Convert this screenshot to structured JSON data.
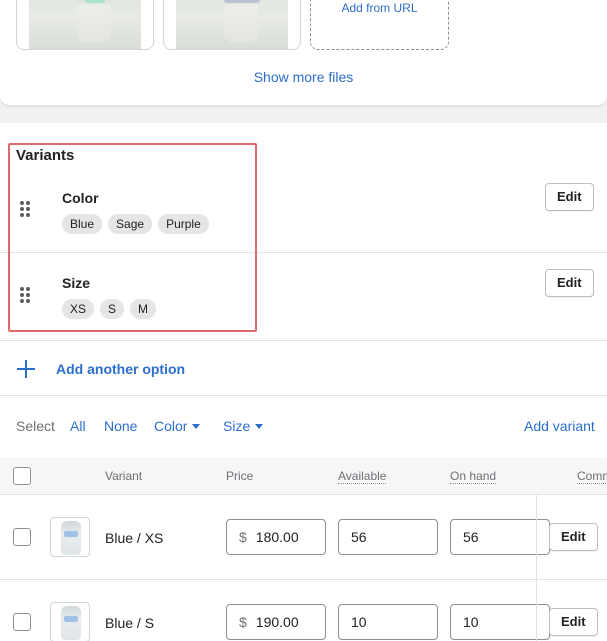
{
  "media": {
    "add_from_url": "Add from URL",
    "show_more": "Show more files"
  },
  "variants": {
    "title": "Variants",
    "options": [
      {
        "name": "Color",
        "values": [
          "Blue",
          "Sage",
          "Purple"
        ],
        "edit_label": "Edit"
      },
      {
        "name": "Size",
        "values": [
          "XS",
          "S",
          "M"
        ],
        "edit_label": "Edit"
      }
    ],
    "add_option_label": "Add another option",
    "highlight_color": "#e06a6a"
  },
  "select_bar": {
    "label": "Select",
    "all": "All",
    "none": "None",
    "color": "Color",
    "size": "Size",
    "add_variant": "Add variant"
  },
  "table": {
    "headers": {
      "variant": "Variant",
      "price": "Price",
      "available": "Available",
      "on_hand": "On hand",
      "committed": "Comm"
    },
    "rows": [
      {
        "variant": "Blue / XS",
        "currency": "$",
        "price": "180.00",
        "available": "56",
        "on_hand": "56",
        "edit_label": "Edit"
      },
      {
        "variant": "Blue / S",
        "currency": "$",
        "price": "190.00",
        "available": "10",
        "on_hand": "10",
        "edit_label": "Edit"
      }
    ]
  },
  "colors": {
    "link": "#2c6ecb",
    "text": "#202223",
    "subdued": "#6d7175",
    "chip_bg": "#e4e5e7"
  }
}
